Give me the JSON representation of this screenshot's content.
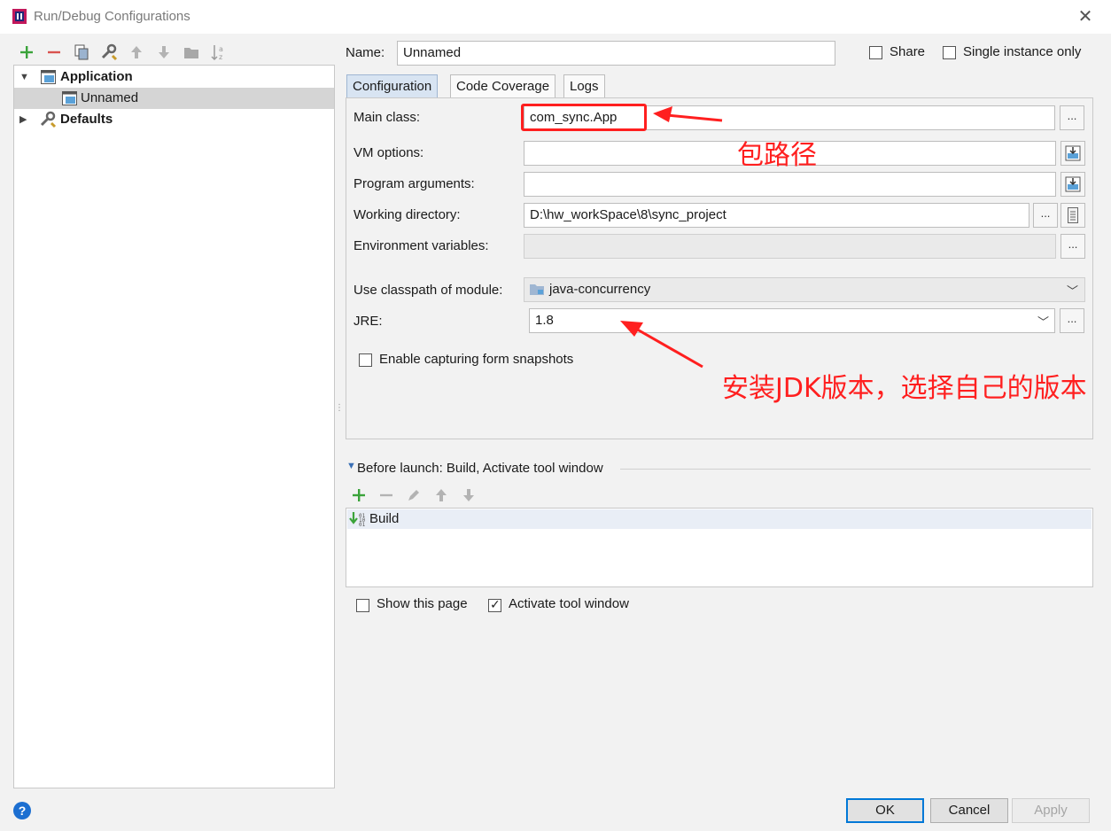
{
  "window": {
    "title": "Run/Debug Configurations"
  },
  "tree": {
    "items": [
      {
        "label": "Application"
      },
      {
        "label": "Unnamed"
      },
      {
        "label": "Defaults"
      }
    ]
  },
  "name_row": {
    "label": "Name:",
    "value": "Unnamed"
  },
  "options": {
    "share_label": "Share",
    "single_instance_label": "Single instance only"
  },
  "tabs": [
    {
      "label": "Configuration"
    },
    {
      "label": "Code Coverage"
    },
    {
      "label": "Logs"
    }
  ],
  "form": {
    "main_class": {
      "label": "Main class:",
      "value": "com_sync.App"
    },
    "vm_options": {
      "label": "VM options:",
      "value": ""
    },
    "program_arguments": {
      "label": "Program arguments:",
      "value": ""
    },
    "working_directory": {
      "label": "Working directory:",
      "value": "D:\\hw_workSpace\\8\\sync_project"
    },
    "environment_variables": {
      "label": "Environment variables:",
      "value": ""
    },
    "classpath_module": {
      "label": "Use classpath of module:",
      "value": "java-concurrency"
    },
    "jre": {
      "label": "JRE:",
      "value": "1.8"
    },
    "enable_capturing": {
      "label": "Enable capturing form snapshots"
    }
  },
  "before_launch": {
    "header": "Before launch: Build, Activate tool window",
    "items": [
      {
        "label": "Build"
      }
    ]
  },
  "footer_checks": {
    "show_page": "Show this page",
    "activate_tool": "Activate tool window"
  },
  "buttons": {
    "ok": "OK",
    "cancel": "Cancel",
    "apply": "Apply",
    "browse": "..."
  },
  "annotations": {
    "package_path": "包路径",
    "jdk_version": "安装JDK版本，选择自己的版本"
  },
  "colors": {
    "accent": "#0078d7",
    "annotation": "#ff1f1f",
    "add_green": "#3aa33a",
    "remove_red": "#d9534f"
  }
}
